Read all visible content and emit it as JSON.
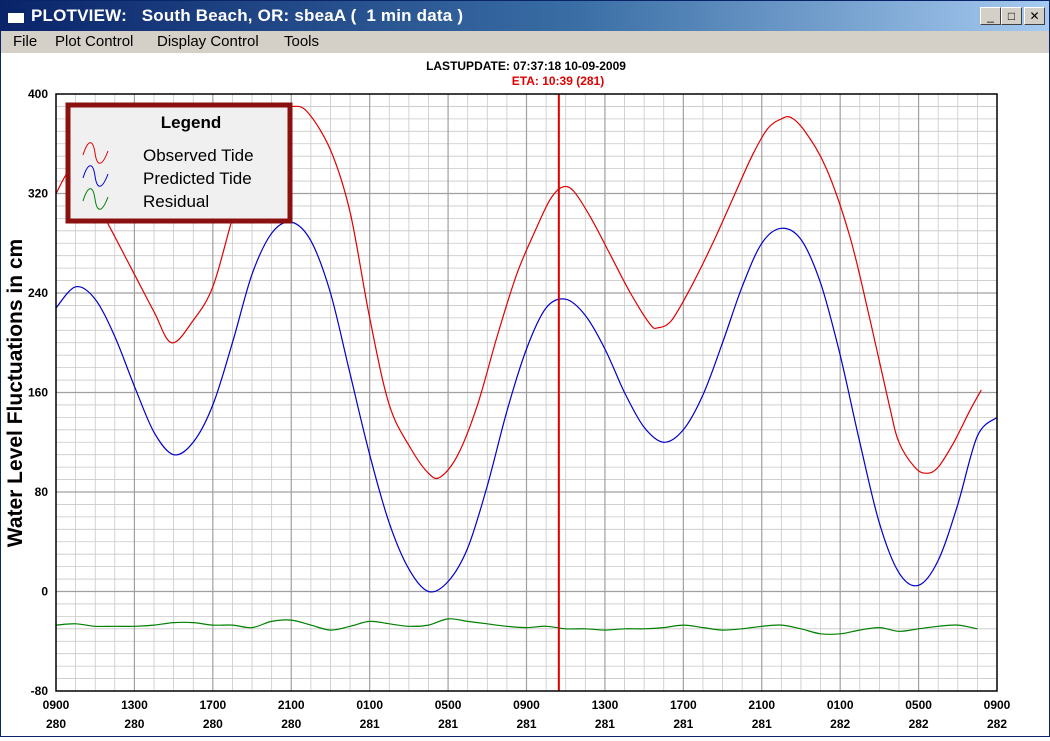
{
  "window": {
    "title": "PLOTVIEW:   South Beach, OR: sbeaA (  1 min data )",
    "controls": {
      "minimize": "_",
      "maximize": "□",
      "close": "✕"
    }
  },
  "menu": {
    "items": [
      "File",
      "Plot Control",
      "Display Control",
      "Tools"
    ]
  },
  "header": {
    "last_update": "LASTUPDATE: 07:37:18  10-09-2009",
    "eta": "ETA: 10:39 (281)"
  },
  "colors": {
    "observed": "#e00000",
    "predicted": "#0000cc",
    "residual": "#008000",
    "eta_line": "#e00000",
    "legend_border": "#8b1010",
    "grid": "#b0b0b0"
  },
  "chart_data": {
    "type": "line",
    "ylabel": "Water Level Fluctuations in cm",
    "ylim": [
      -80,
      400
    ],
    "yticks": [
      -80,
      0,
      80,
      160,
      240,
      320,
      400
    ],
    "xlim": [
      0,
      48
    ],
    "x_unit": "hours since 0900 day 280",
    "xticks": [
      {
        "x": 0,
        "time": "0900",
        "day": "280"
      },
      {
        "x": 4,
        "time": "1300",
        "day": "280"
      },
      {
        "x": 8,
        "time": "1700",
        "day": "280"
      },
      {
        "x": 12,
        "time": "2100",
        "day": "280"
      },
      {
        "x": 16,
        "time": "0100",
        "day": "281"
      },
      {
        "x": 20,
        "time": "0500",
        "day": "281"
      },
      {
        "x": 24,
        "time": "0900",
        "day": "281"
      },
      {
        "x": 28,
        "time": "1300",
        "day": "281"
      },
      {
        "x": 32,
        "time": "1700",
        "day": "281"
      },
      {
        "x": 36,
        "time": "2100",
        "day": "281"
      },
      {
        "x": 40,
        "time": "0100",
        "day": "282"
      },
      {
        "x": 44,
        "time": "0500",
        "day": "282"
      },
      {
        "x": 48,
        "time": "0900",
        "day": "282"
      }
    ],
    "eta_x": 25.65,
    "legend": {
      "title": "Legend",
      "position": "top-left"
    },
    "series": [
      {
        "name": "Observed Tide",
        "color": "#e00000",
        "points": [
          [
            0,
            320
          ],
          [
            0.8,
            340
          ],
          [
            1.5,
            325
          ],
          [
            2.5,
            300
          ],
          [
            4,
            255
          ],
          [
            5,
            225
          ],
          [
            5.9,
            200
          ],
          [
            7,
            218
          ],
          [
            8,
            245
          ],
          [
            9,
            300
          ],
          [
            10,
            350
          ],
          [
            11.3,
            388
          ],
          [
            12,
            390
          ],
          [
            12.8,
            386
          ],
          [
            14,
            355
          ],
          [
            15,
            305
          ],
          [
            16,
            220
          ],
          [
            17,
            150
          ],
          [
            18.1,
            115
          ],
          [
            19,
            95
          ],
          [
            19.6,
            92
          ],
          [
            20.5,
            110
          ],
          [
            21.5,
            150
          ],
          [
            22.5,
            205
          ],
          [
            23.5,
            255
          ],
          [
            24.5,
            292
          ],
          [
            25.2,
            315
          ],
          [
            25.8,
            325
          ],
          [
            26.4,
            322
          ],
          [
            27.3,
            300
          ],
          [
            28.3,
            270
          ],
          [
            29.3,
            240
          ],
          [
            30.3,
            215
          ],
          [
            30.7,
            212
          ],
          [
            31.4,
            218
          ],
          [
            32.4,
            245
          ],
          [
            33.5,
            280
          ],
          [
            34.5,
            315
          ],
          [
            35.5,
            350
          ],
          [
            36.3,
            372
          ],
          [
            37,
            380
          ],
          [
            37.5,
            381
          ],
          [
            38.2,
            370
          ],
          [
            39.3,
            340
          ],
          [
            40.5,
            285
          ],
          [
            41.5,
            220
          ],
          [
            42.5,
            150
          ],
          [
            43,
            120
          ],
          [
            43.8,
            100
          ],
          [
            44.4,
            95
          ],
          [
            45,
            100
          ],
          [
            45.8,
            120
          ],
          [
            46.6,
            145
          ],
          [
            47.2,
            162
          ]
        ]
      },
      {
        "name": "Predicted Tide",
        "color": "#0000cc",
        "points": [
          [
            0,
            228
          ],
          [
            1,
            245
          ],
          [
            2,
            235
          ],
          [
            3,
            205
          ],
          [
            4,
            165
          ],
          [
            5,
            128
          ],
          [
            6,
            110
          ],
          [
            7,
            120
          ],
          [
            8,
            150
          ],
          [
            9,
            200
          ],
          [
            10,
            255
          ],
          [
            11,
            288
          ],
          [
            12,
            297
          ],
          [
            13,
            282
          ],
          [
            14,
            240
          ],
          [
            15,
            175
          ],
          [
            16,
            110
          ],
          [
            17,
            55
          ],
          [
            18,
            18
          ],
          [
            19,
            0
          ],
          [
            20,
            8
          ],
          [
            21,
            35
          ],
          [
            22,
            85
          ],
          [
            23,
            145
          ],
          [
            24,
            195
          ],
          [
            25,
            228
          ],
          [
            26,
            235
          ],
          [
            27,
            222
          ],
          [
            28,
            195
          ],
          [
            29,
            160
          ],
          [
            30,
            132
          ],
          [
            31,
            120
          ],
          [
            32,
            130
          ],
          [
            33,
            158
          ],
          [
            34,
            200
          ],
          [
            35,
            245
          ],
          [
            36,
            280
          ],
          [
            37,
            292
          ],
          [
            38,
            283
          ],
          [
            39,
            248
          ],
          [
            40,
            190
          ],
          [
            41,
            120
          ],
          [
            42,
            55
          ],
          [
            43,
            15
          ],
          [
            44,
            5
          ],
          [
            45,
            25
          ],
          [
            46,
            70
          ],
          [
            47,
            125
          ],
          [
            48,
            140
          ]
        ]
      },
      {
        "name": "Residual",
        "color": "#008000",
        "points": [
          [
            0,
            -27
          ],
          [
            1,
            -26
          ],
          [
            2,
            -28
          ],
          [
            3,
            -28
          ],
          [
            4,
            -28
          ],
          [
            5,
            -27
          ],
          [
            6,
            -25
          ],
          [
            7,
            -25
          ],
          [
            8,
            -27
          ],
          [
            9,
            -27
          ],
          [
            10,
            -29
          ],
          [
            11,
            -24
          ],
          [
            12,
            -23
          ],
          [
            13,
            -27
          ],
          [
            14,
            -31
          ],
          [
            15,
            -28
          ],
          [
            16,
            -24
          ],
          [
            17,
            -26
          ],
          [
            18,
            -28
          ],
          [
            19,
            -27
          ],
          [
            20,
            -22
          ],
          [
            21,
            -24
          ],
          [
            22,
            -26
          ],
          [
            23,
            -28
          ],
          [
            24,
            -29
          ],
          [
            25,
            -28
          ],
          [
            26,
            -30
          ],
          [
            27,
            -30
          ],
          [
            28,
            -31
          ],
          [
            29,
            -30
          ],
          [
            30,
            -30
          ],
          [
            31,
            -29
          ],
          [
            32,
            -27
          ],
          [
            33,
            -29
          ],
          [
            34,
            -31
          ],
          [
            35,
            -30
          ],
          [
            36,
            -28
          ],
          [
            37,
            -27
          ],
          [
            38,
            -30
          ],
          [
            39,
            -34
          ],
          [
            40,
            -34
          ],
          [
            41,
            -31
          ],
          [
            42,
            -29
          ],
          [
            43,
            -32
          ],
          [
            44,
            -30
          ],
          [
            45,
            -28
          ],
          [
            46,
            -27
          ],
          [
            47,
            -30
          ]
        ]
      }
    ]
  }
}
